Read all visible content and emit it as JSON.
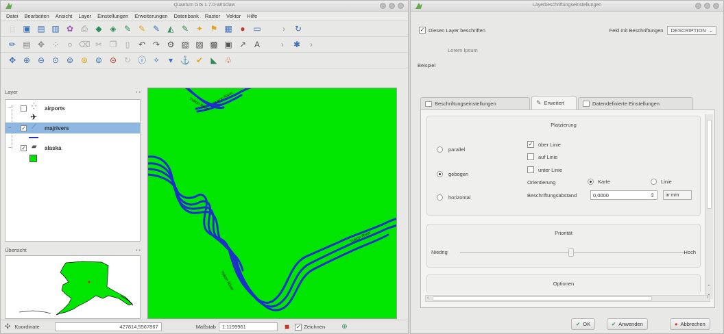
{
  "qgis": {
    "title": "Quantum GIS 1.7.0-Wroclaw",
    "menu": [
      "Datei",
      "Bearbeiten",
      "Ansicht",
      "Layer",
      "Einstellungen",
      "Erweiterungen",
      "Datenbank",
      "Raster",
      "Vektor",
      "Hilfe"
    ],
    "layers_panel_title": "Layer",
    "layers": [
      {
        "name": "airports",
        "checked": false,
        "icon": "point-layer-icon"
      },
      {
        "name": "majrivers",
        "checked": true,
        "icon": "line-layer-icon",
        "selected": true
      },
      {
        "name": "alaska",
        "checked": true,
        "icon": "polygon-layer-icon"
      }
    ],
    "overview_title": "Übersicht",
    "map": {
      "background": "#00e600",
      "river_color": "#1f2fcc",
      "river_labels": [
        "Yukon River",
        "Yukon River",
        "Yukon River",
        "Yukon River"
      ]
    },
    "status": {
      "coord_label": "Koordinate",
      "coord_value": "427814,5567867",
      "scale_label": "Maßstab",
      "scale_value": "1:1199961",
      "render_label": "Zeichnen"
    }
  },
  "dialog": {
    "title": "Layerbeschriftungseinstellungen",
    "label_layer": "Diesen Layer beschriften",
    "field_label": "Feld mit Beschriftungen",
    "field_value": "DESCRIPTION",
    "preview_text": "Lorem Ipsum",
    "sample_label": "Beispiel",
    "tabs": [
      "Beschriftungseinstellungen",
      "Erweitert",
      "Datendefinierte Einstellungen"
    ],
    "placement": {
      "title": "Platzierung",
      "modes": [
        "parallel",
        "gebogen",
        "horizontal"
      ],
      "selected_mode": "gebogen",
      "line_options": [
        "über Linie",
        "auf Linie",
        "unter Linie"
      ],
      "line_checked": [
        true,
        false,
        false
      ],
      "orientation_label": "Orientierung",
      "orientation_options": [
        "Karte",
        "Linie"
      ],
      "distance_label": "Beschriftungsabstand",
      "distance_value": "0,0000",
      "unit": "in mm"
    },
    "priority": {
      "title": "Priorität",
      "low_label": "Niedrig",
      "high_label": "Hoch"
    },
    "options_title": "Optionen",
    "buttons": {
      "ok": "OK",
      "apply": "Anwenden",
      "cancel": "Abbrechen"
    }
  }
}
